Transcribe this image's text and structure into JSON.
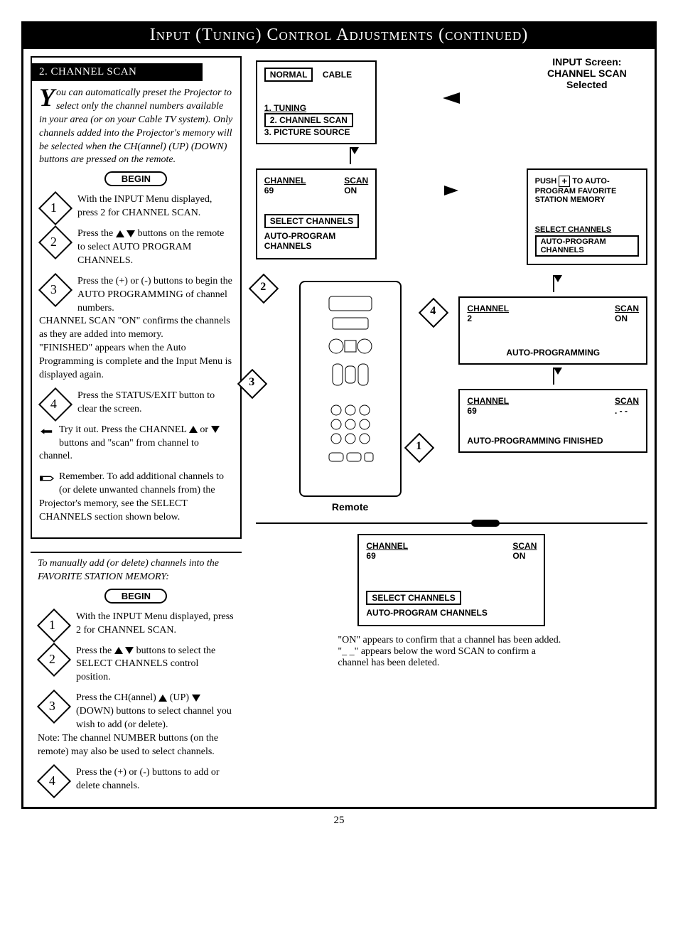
{
  "header": "Input (Tuning) Control Adjustments (continued)",
  "pageNumber": "25",
  "sectionA": {
    "title": "2. CHANNEL SCAN",
    "intro": "ou can automatically preset the Projector to select only the channel numbers available in your area (or on your Cable TV system). Only channels added into the Projector's memory will be selected when the CH(annel)  (UP)  (DOWN) buttons are pressed on the remote.",
    "begin": "BEGIN",
    "step1": "With the INPUT Menu displayed, press 2 for CHANNEL SCAN.",
    "step2": "Press the   buttons on the remote to select AUTO PROGRAM CHANNELS.",
    "step3a": "Press the (+) or (-) buttons to begin the AUTO PROGRAMMING of channel numbers.",
    "step3b": "CHANNEL SCAN \"ON\" confirms the channels as they are added into memory.",
    "step3c": "\"FINISHED\" appears when the Auto Programming is complete and the Input Menu is displayed again.",
    "step4": "Press the STATUS/EXIT button to clear the screen.",
    "try": "Try it out. Press the CHANNEL  or  buttons and \"scan\" from channel to channel.",
    "remember": "Remember. To add additional channels to (or delete unwanted channels from) the Projector's memory, see the SELECT CHANNELS section shown below."
  },
  "sectionB": {
    "intro": "To manually add (or delete) channels into the FAVORITE STATION MEMORY:",
    "begin": "BEGIN",
    "step1": "With the INPUT Menu displayed, press 2 for CHANNEL SCAN.",
    "step2": "Press the   buttons to select the SELECT CHANNELS control position.",
    "step3a": "Press the CH(annel)  (UP)  (DOWN) buttons to select channel you wish to add (or delete).",
    "step3b": "Note: The channel NUMBER buttons (on the remote) may also be used to select channels.",
    "step4": "Press the (+) or (-) buttons to add or delete channels."
  },
  "rightSide": {
    "inputScreen": {
      "normal": "NORMAL",
      "cable": "CABLE",
      "m1": "1. TUNING",
      "m2": "2. CHANNEL SCAN",
      "m3": "3. PICTURE SOURCE"
    },
    "caption1a": "INPUT Screen:",
    "caption1b": "CHANNEL SCAN",
    "caption1c": "Selected",
    "chScan": {
      "ch": "CHANNEL",
      "chv": "69",
      "sc": "SCAN",
      "scv": "ON",
      "sel": "SELECT CHANNELS",
      "auto": "AUTO-PROGRAM CHANNELS"
    },
    "push": "PUSH  TO AUTO-PROGRAM FAVORITE STATION MEMORY",
    "selBoxed": "SELECT CHANNELS",
    "autoBoxed": "AUTO-PROGRAM CHANNELS",
    "prog2": {
      "ch": "CHANNEL",
      "chv": "2",
      "sc": "SCAN",
      "scv": "ON"
    },
    "autoProg": "AUTO-PROGRAMMING",
    "prog69": {
      "ch": "CHANNEL",
      "chv": "69",
      "sc": "SCAN",
      "scv": ". - -"
    },
    "finished": "AUTO-PROGRAMMING FINISHED",
    "remoteLabel": "Remote",
    "bottomScreen": {
      "ch": "CHANNEL",
      "chv": "69",
      "sc": "SCAN",
      "scv": "ON",
      "sel": "SELECT CHANNELS",
      "auto": "AUTO-PROGRAM CHANNELS"
    },
    "note1": "\"ON\" appears to confirm that a channel has been added.",
    "note2": "\"_ _\" appears below the word SCAN to confirm a channel has been deleted."
  }
}
